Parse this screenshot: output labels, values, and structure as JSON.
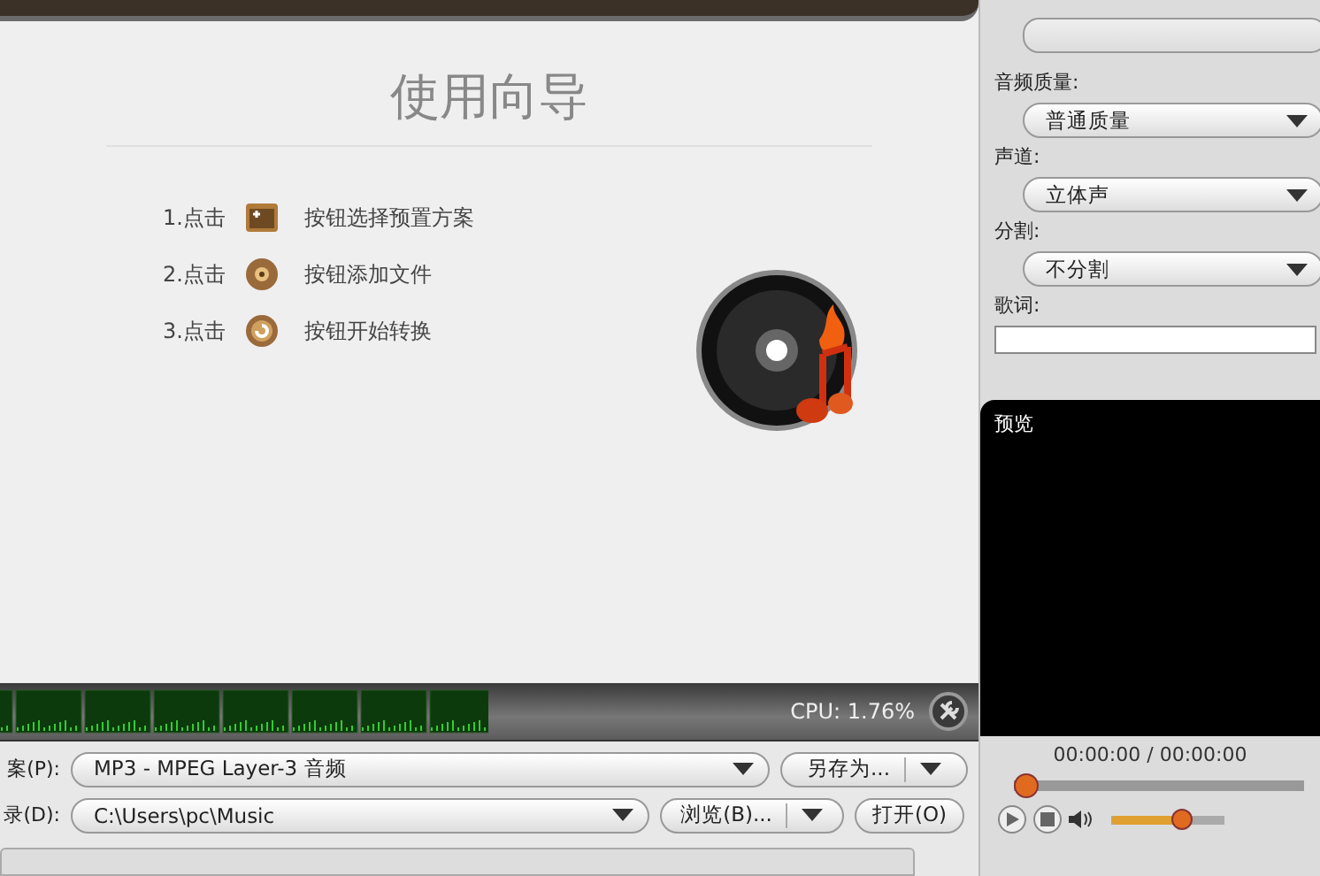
{
  "wizard": {
    "title": "使用向导",
    "steps": [
      {
        "prefix": "1.点击",
        "text": "按钮选择预置方案",
        "kind": "preset"
      },
      {
        "prefix": "2.点击",
        "text": "按钮添加文件",
        "kind": "add"
      },
      {
        "prefix": "3.点击",
        "text": "按钮开始转换",
        "kind": "convert"
      }
    ]
  },
  "status": {
    "cpu": "CPU: 1.76%"
  },
  "profile": {
    "label": "案(P):",
    "value": "MP3 - MPEG Layer-3 音频",
    "save_as": "另存为..."
  },
  "output": {
    "label": "录(D):",
    "value": "C:\\Users\\pc\\Music",
    "browse": "浏览(B)...",
    "open": "打开(O)"
  },
  "settings": [
    {
      "kind": "blank"
    },
    {
      "kind": "select",
      "label": "音频质量:",
      "value": "普通质量"
    },
    {
      "kind": "select",
      "label": "声道:",
      "value": "立体声"
    },
    {
      "kind": "select",
      "label": "分割:",
      "value": "不分割"
    },
    {
      "kind": "text",
      "label": "歌词:"
    }
  ],
  "preview": {
    "title": "预览",
    "time": "00:00:00 / 00:00:00",
    "seek": {
      "level": 0
    },
    "volume": {
      "level": 0.66
    }
  }
}
